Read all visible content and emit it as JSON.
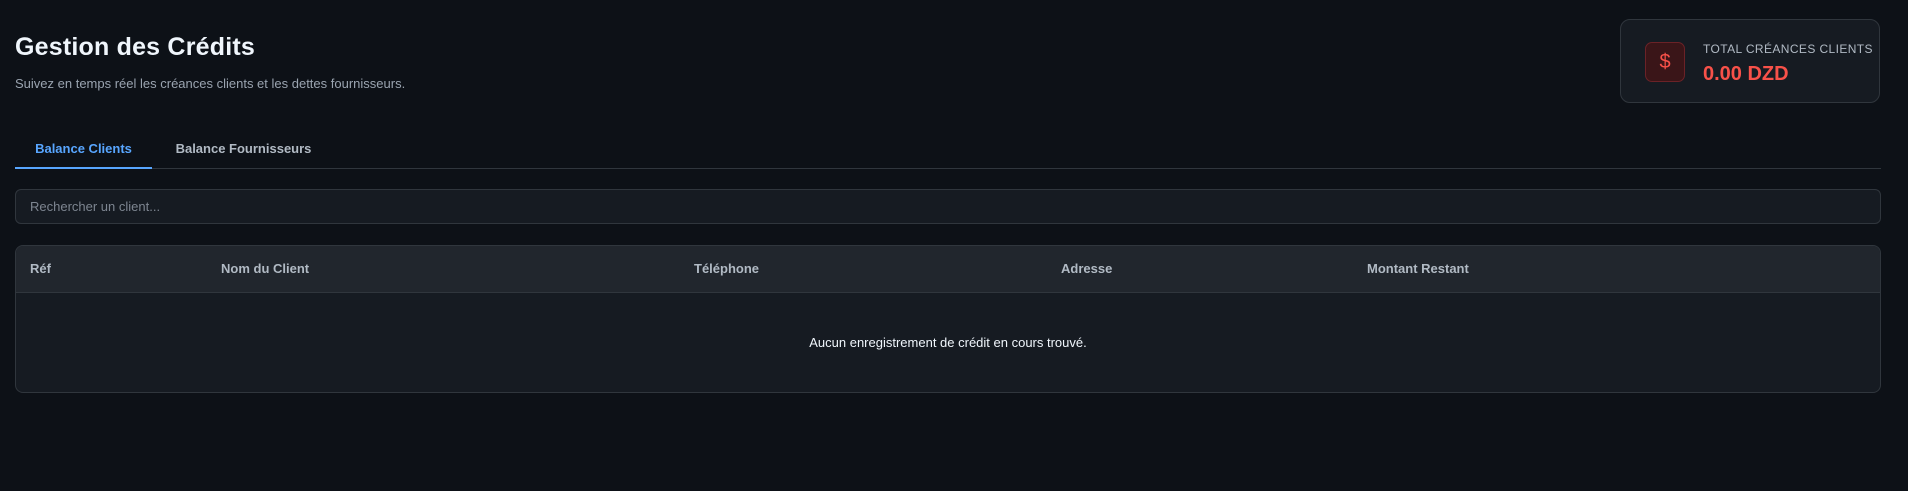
{
  "header": {
    "title": "Gestion des Crédits",
    "subtitle": "Suivez en temps réel les créances clients et les dettes fournisseurs."
  },
  "summary": {
    "icon": "dollar-icon",
    "icon_glyph": "$",
    "label": "TOTAL CRÉANCES CLIENTS",
    "value": "0.00 DZD",
    "accent_color": "#f85149"
  },
  "tabs": [
    {
      "label": "Balance Clients",
      "active": true
    },
    {
      "label": "Balance Fournisseurs",
      "active": false
    }
  ],
  "search": {
    "placeholder": "Rechercher un client...",
    "value": ""
  },
  "table": {
    "columns": [
      "Réf",
      "Nom du Client",
      "Téléphone",
      "Adresse",
      "Montant Restant"
    ],
    "rows": [],
    "empty_message": "Aucun enregistrement de crédit en cours trouvé."
  },
  "colors": {
    "background": "#0d1117",
    "surface": "#161b22",
    "active_tab": "#58a6ff"
  }
}
